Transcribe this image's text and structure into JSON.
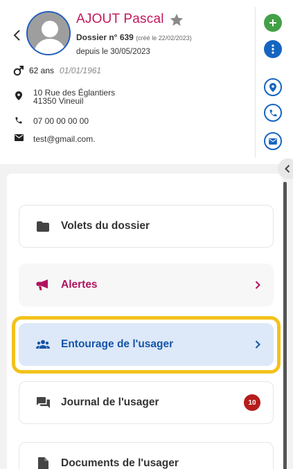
{
  "patient": {
    "name": "AJOUT Pascal",
    "dossier_label": "Dossier n° 639",
    "cree_le": "(créé le 22/02/2023)",
    "depuis": "depuis le 30/05/2023",
    "age": "62 ans",
    "birthdate": "01/01/1961",
    "address_line1": "10 Rue des Églantiers",
    "address_line2": "41350 Vineuil",
    "phone": "07 00 00 00 00",
    "email": "test@gmail.com."
  },
  "actions": {
    "add_symbol": "+",
    "more_symbol": "⋮"
  },
  "menu": [
    {
      "label": "Volets du dossier",
      "icon": "folder-icon"
    },
    {
      "label": "Alertes",
      "icon": "megaphone-icon"
    },
    {
      "label": "Entourage de l'usager",
      "icon": "people-icon"
    },
    {
      "label": "Journal de l'usager",
      "icon": "chat-icon",
      "badge": "10"
    },
    {
      "label": "Documents de l'usager",
      "icon": "document-icon"
    }
  ],
  "colors": {
    "name": "#c2185b",
    "alert": "#b0135e",
    "selected_bg": "#dde9f8",
    "selected_text": "#1654a8",
    "highlight": "#f2c21b",
    "badge": "#b71c1c"
  }
}
